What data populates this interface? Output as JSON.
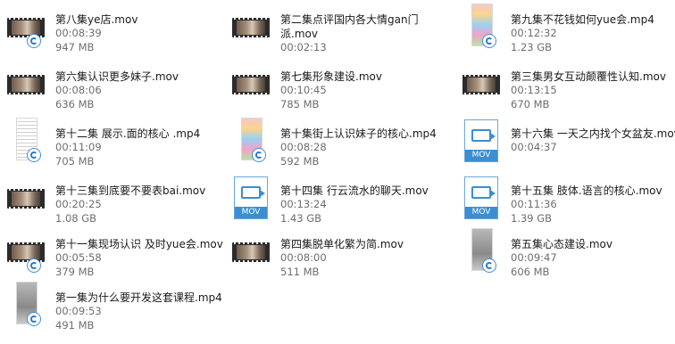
{
  "files": [
    {
      "name": "第八集ye店.mov",
      "duration": "00:08:39",
      "size": "947 MB",
      "thumb": "video-icon"
    },
    {
      "name": "第二集点评国内各大情gan门派.mov",
      "duration": "00:02:13",
      "size": "",
      "thumb": "video-icon"
    },
    {
      "name": "第九集不花钱如何yue会.mp4",
      "duration": "00:12:32",
      "size": "1.23 GB",
      "thumb": "phone-colorful-icon"
    },
    {
      "name": "第六集认识更多妹子.mov",
      "duration": "00:08:06",
      "size": "636 MB",
      "thumb": "video-icon"
    },
    {
      "name": "第七集形象建设.mov",
      "duration": "00:10:45",
      "size": "785 MB",
      "thumb": "video-icon"
    },
    {
      "name": "第三集男女互动颠覆性认知.mov",
      "duration": "00:13:15",
      "size": "670 MB",
      "thumb": "video-icon"
    },
    {
      "name": "第十二集 展示.面的核心 .mp4",
      "duration": "00:11:09",
      "size": "705 MB",
      "thumb": "phone-list-icon"
    },
    {
      "name": "第十集街上认识妹子的核心.mp4",
      "duration": "00:08:28",
      "size": "592 MB",
      "thumb": "phone-colorful-icon"
    },
    {
      "name": "第十六集 一天之内找个女盆友.mov",
      "duration": "00:04:37",
      "size": "",
      "thumb": "mov-file-icon"
    },
    {
      "name": "第十三集到底要不要表bai.mov",
      "duration": "00:20:25",
      "size": "1.08 GB",
      "thumb": "video-icon"
    },
    {
      "name": "第十四集 行云流水的聊天.mov",
      "duration": "00:13:24",
      "size": "1.43 GB",
      "thumb": "mov-file-icon"
    },
    {
      "name": "第十五集 肢体.语言的核心.mov",
      "duration": "00:11:36",
      "size": "1.39 GB",
      "thumb": "mov-file-icon"
    },
    {
      "name": "第十一集现场认识 及时yue会.mov",
      "duration": "00:05:58",
      "size": "379 MB",
      "thumb": "video-icon"
    },
    {
      "name": "第四集脱单化繁为简.mov",
      "duration": "00:08:00",
      "size": "511 MB",
      "thumb": "video-icon"
    },
    {
      "name": "第五集心态建设.mov",
      "duration": "00:09:47",
      "size": "606 MB",
      "thumb": "phone-grey-icon"
    },
    {
      "name": "第一集为什么要开发这套课程.mp4",
      "duration": "00:09:53",
      "size": "491 MB",
      "thumb": "phone-grey-icon"
    }
  ],
  "labels": {
    "mov": "MOV"
  }
}
